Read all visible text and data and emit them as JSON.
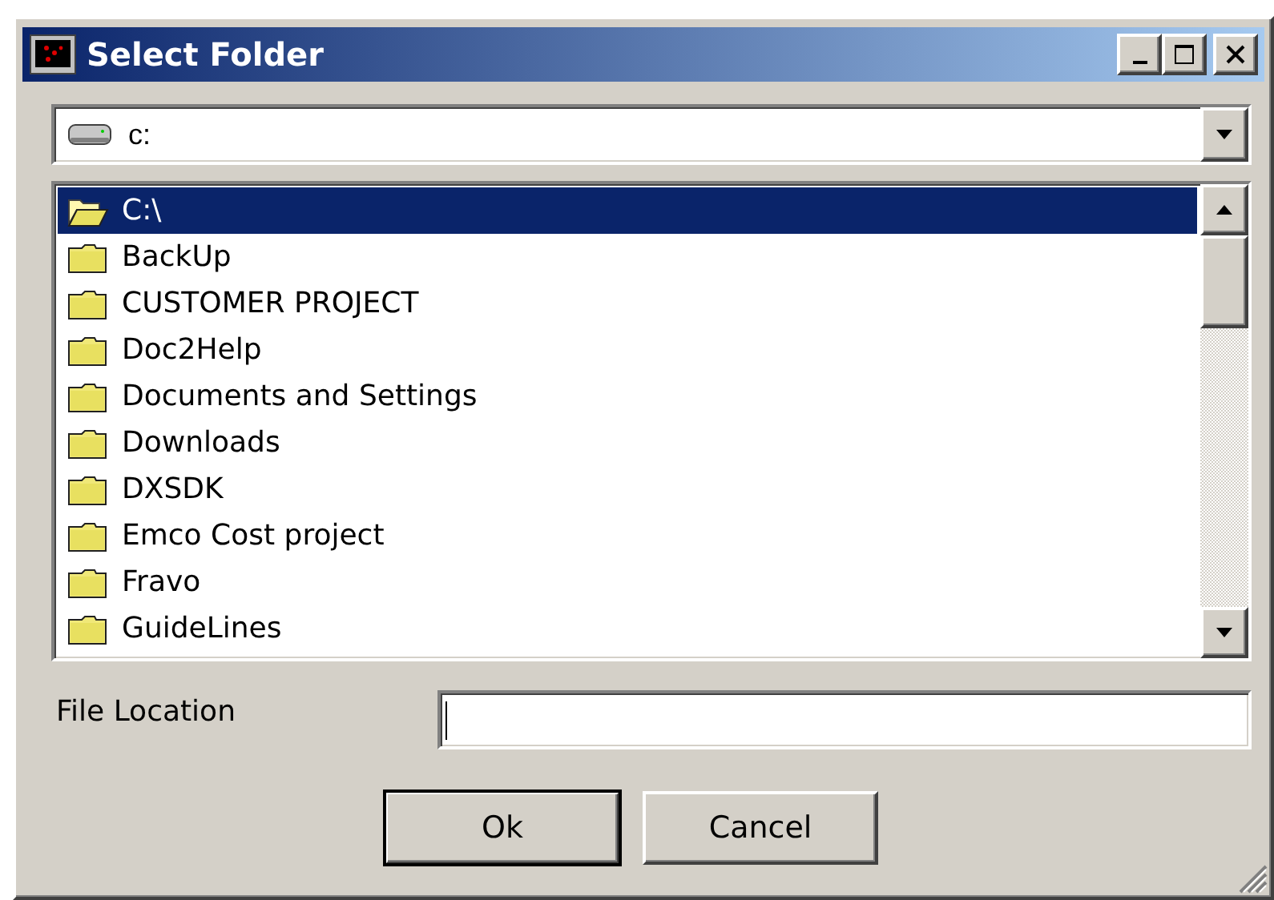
{
  "window": {
    "title": "Select Folder"
  },
  "drive_combo": {
    "value": "c:"
  },
  "folders": [
    {
      "name": "C:\\",
      "selected": true
    },
    {
      "name": "BackUp",
      "selected": false
    },
    {
      "name": "CUSTOMER PROJECT",
      "selected": false
    },
    {
      "name": "Doc2Help",
      "selected": false
    },
    {
      "name": "Documents and Settings",
      "selected": false
    },
    {
      "name": "Downloads",
      "selected": false
    },
    {
      "name": "DXSDK",
      "selected": false
    },
    {
      "name": "Emco Cost project",
      "selected": false
    },
    {
      "name": "Fravo",
      "selected": false
    },
    {
      "name": "GuideLines",
      "selected": false
    }
  ],
  "file_location": {
    "label": "File Location"
  },
  "buttons": [
    {
      "label": "Ok",
      "default": true
    },
    {
      "label": "Cancel",
      "default": false
    }
  ]
}
